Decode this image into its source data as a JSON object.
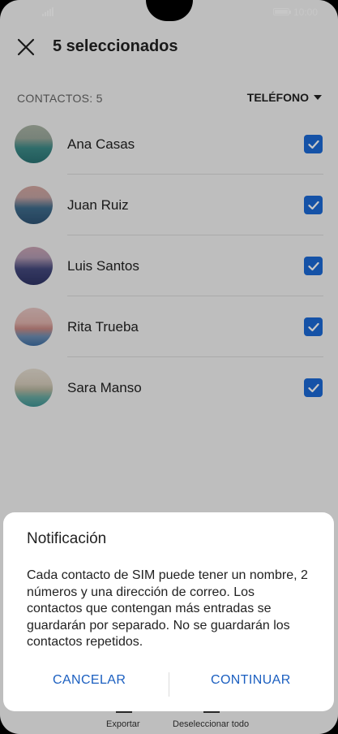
{
  "status_bar": {
    "time": "10:00"
  },
  "header": {
    "title": "5 seleccionados"
  },
  "section": {
    "label": "CONTACTOS: 5",
    "filter": "TELÉFONO"
  },
  "contacts": [
    {
      "name": "Ana Casas",
      "checked": true
    },
    {
      "name": "Juan Ruiz",
      "checked": true
    },
    {
      "name": "Luis Santos",
      "checked": true
    },
    {
      "name": "Rita Trueba",
      "checked": true
    },
    {
      "name": "Sara Manso",
      "checked": true
    }
  ],
  "bottom_bar": {
    "export_label": "Exportar",
    "deselect_label": "Deseleccionar todo"
  },
  "dialog": {
    "title": "Notificación",
    "body": "Cada contacto de SIM puede tener un nombre, 2 números y una dirección de correo. Los contactos que contengan más entradas se guardarán por separado. No se guardarán los contactos repetidos.",
    "cancel_label": "CANCELAR",
    "continue_label": "CONTINUAR"
  },
  "colors": {
    "accent": "#1b69d6",
    "dialog_button": "#1b5fc0"
  },
  "icons": [
    "close-icon",
    "signal-icon",
    "battery-icon",
    "chevron-down-icon",
    "checkbox-checked-icon",
    "export-icon",
    "deselect-icon"
  ]
}
